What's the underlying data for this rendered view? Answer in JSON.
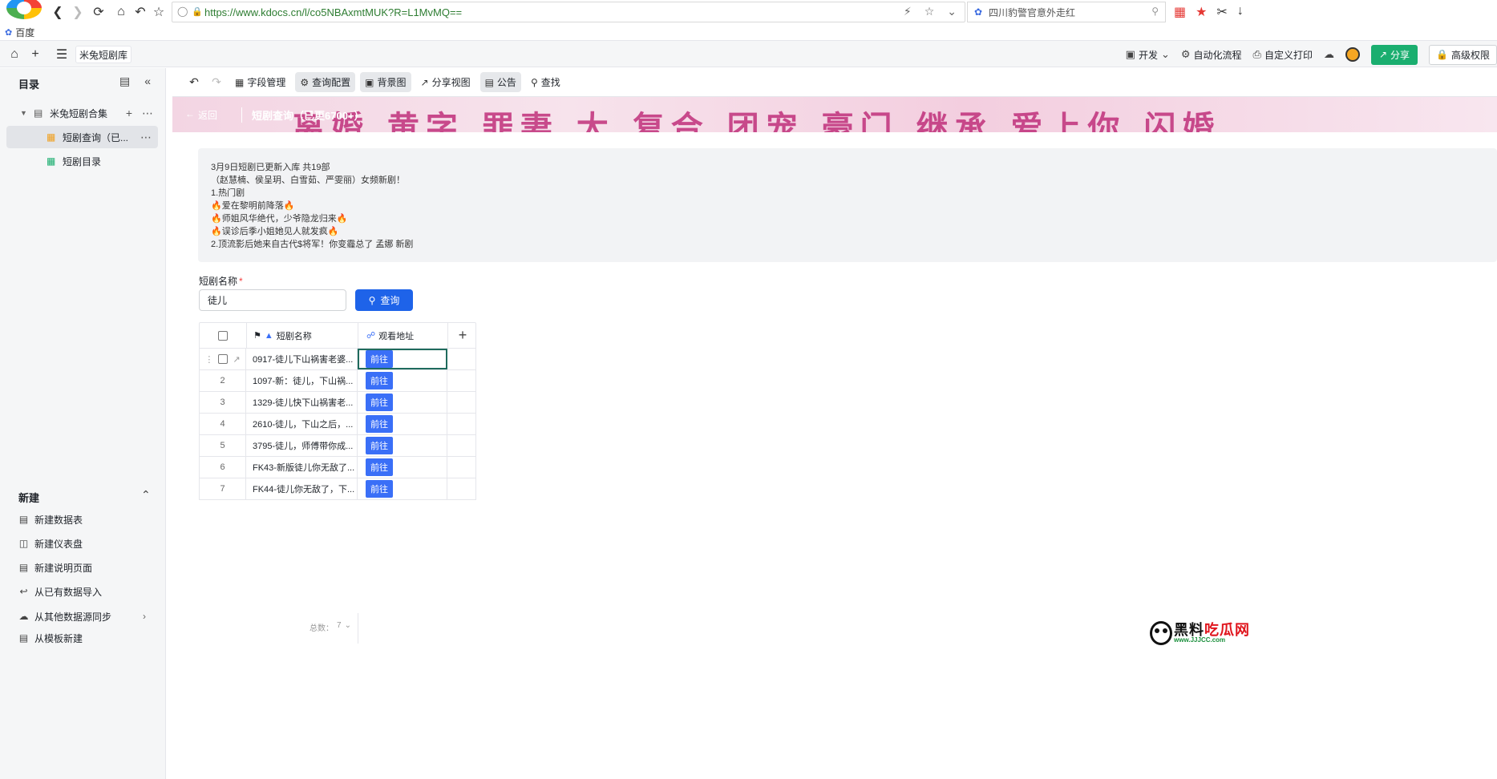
{
  "browser": {
    "url": "https://www.kdocs.cn/l/co5NBAxmtMUK?R=L1MvMQ==",
    "search_text": "四川豹警官意外走红",
    "bookmark": "百度"
  },
  "app": {
    "tab_title": "米兔短剧库",
    "top_actions": {
      "dev": "开发",
      "automation": "自动化流程",
      "print": "自定义打印",
      "share": "分享",
      "permission": "高级权限"
    }
  },
  "sidebar": {
    "heading": "目录",
    "tree": [
      {
        "label": "米兔短剧合集"
      },
      {
        "label": "短剧查询（已..."
      },
      {
        "label": "短剧目录"
      }
    ],
    "new_heading": "新建",
    "new_items": [
      {
        "label": "新建数据表"
      },
      {
        "label": "新建仪表盘"
      },
      {
        "label": "新建说明页面"
      },
      {
        "label": "从已有数据导入"
      },
      {
        "label": "从其他数据源同步"
      },
      {
        "label": "从模板新建"
      }
    ]
  },
  "toolbar": {
    "fields": "字段管理",
    "query_config": "查询配置",
    "background": "背景图",
    "share_view": "分享视图",
    "notice": "公告",
    "find": "查找"
  },
  "banner": {
    "back": "返回",
    "title": "短剧查询（已更6700+）",
    "art_text": "离婚 黄字 罪妻 大 复合 团宠 豪门 继承 爱上你 闪婚"
  },
  "notice": {
    "lines": [
      "3月9日短剧已更新入库 共19部",
      "（赵慧楠、侯呈玥、白雪茹、严雯丽）女频新剧！",
      "1.热门剧",
      "🔥爱在黎明前降落🔥",
      "🔥师姐风华绝代，少爷隐龙归来🔥",
      "🔥误诊后季小姐她见人就发疯🔥",
      "2.顶流影后她来自古代$将军！你变霾总了 孟娜 新剧"
    ]
  },
  "query": {
    "label": "短剧名称",
    "required_mark": "*",
    "value": "徒儿",
    "button": "查询"
  },
  "grid": {
    "columns": [
      "短剧名称",
      "观看地址"
    ],
    "go_label": "前往",
    "rows": [
      {
        "num": "1",
        "name": "0917-徒儿下山祸害老婆..."
      },
      {
        "num": "2",
        "name": "1097-新：徒儿，下山祸..."
      },
      {
        "num": "3",
        "name": "1329-徒儿快下山祸害老..."
      },
      {
        "num": "4",
        "name": "2610-徒儿，下山之后，..."
      },
      {
        "num": "5",
        "name": "3795-徒儿，师傅带你成..."
      },
      {
        "num": "6",
        "name": "FK43-新版徒儿你无敌了..."
      },
      {
        "num": "7",
        "name": "FK44-徒儿你无敌了，下..."
      }
    ],
    "total_label": "总数：",
    "total": "7"
  },
  "watermark": {
    "main_a": "黑料",
    "main_b": "吃瓜网",
    "sub": "www.JJJCC.com"
  }
}
